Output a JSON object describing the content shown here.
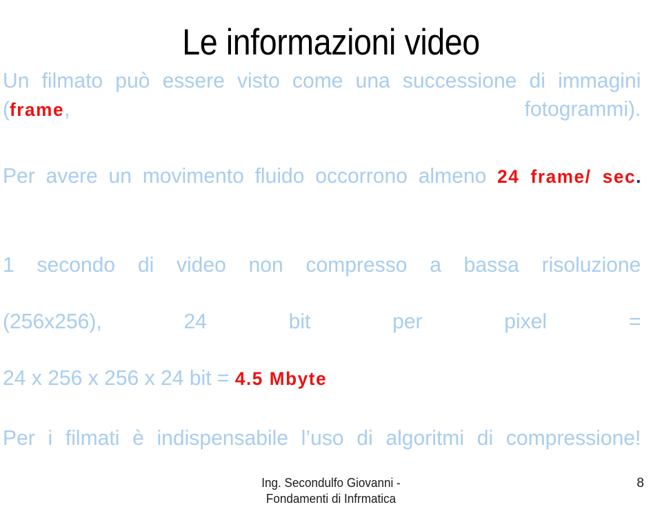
{
  "slide": {
    "title": "Le informazioni video",
    "page_number": "8",
    "colors": {
      "title": "#000000",
      "body_text": "#a9cdee",
      "highlight_red": "#ee1111",
      "highlight_navy": "#1f2a66",
      "background": "#ffffff",
      "footer_text": "#1a1a1a"
    }
  },
  "paragraphs": {
    "p1": {
      "part1": "Un filmato può essere visto come una successione di immagini (",
      "highlight": "frame",
      "part2": ", fotogrammi)."
    },
    "p2": {
      "part1": "Per avere un movimento fluido occorrono almeno ",
      "highlight": "24 frame/ sec",
      "terminator": "."
    },
    "p3": {
      "line1": "1 secondo di video non compresso a bassa risoluzione",
      "line2": "(256x256), 24 bit per pixel =",
      "line3_prefix": "24 x 256 x 256 x 24 bit = ",
      "line3_highlight": "4.5 Mbyte"
    },
    "p4": {
      "text": "Per i filmati è indispensabile l’uso di algoritmi di compressione!"
    }
  },
  "footer": {
    "line1": "Ing. Secondulfo Giovanni -",
    "line2": "Fondamenti di Infrmatica"
  }
}
